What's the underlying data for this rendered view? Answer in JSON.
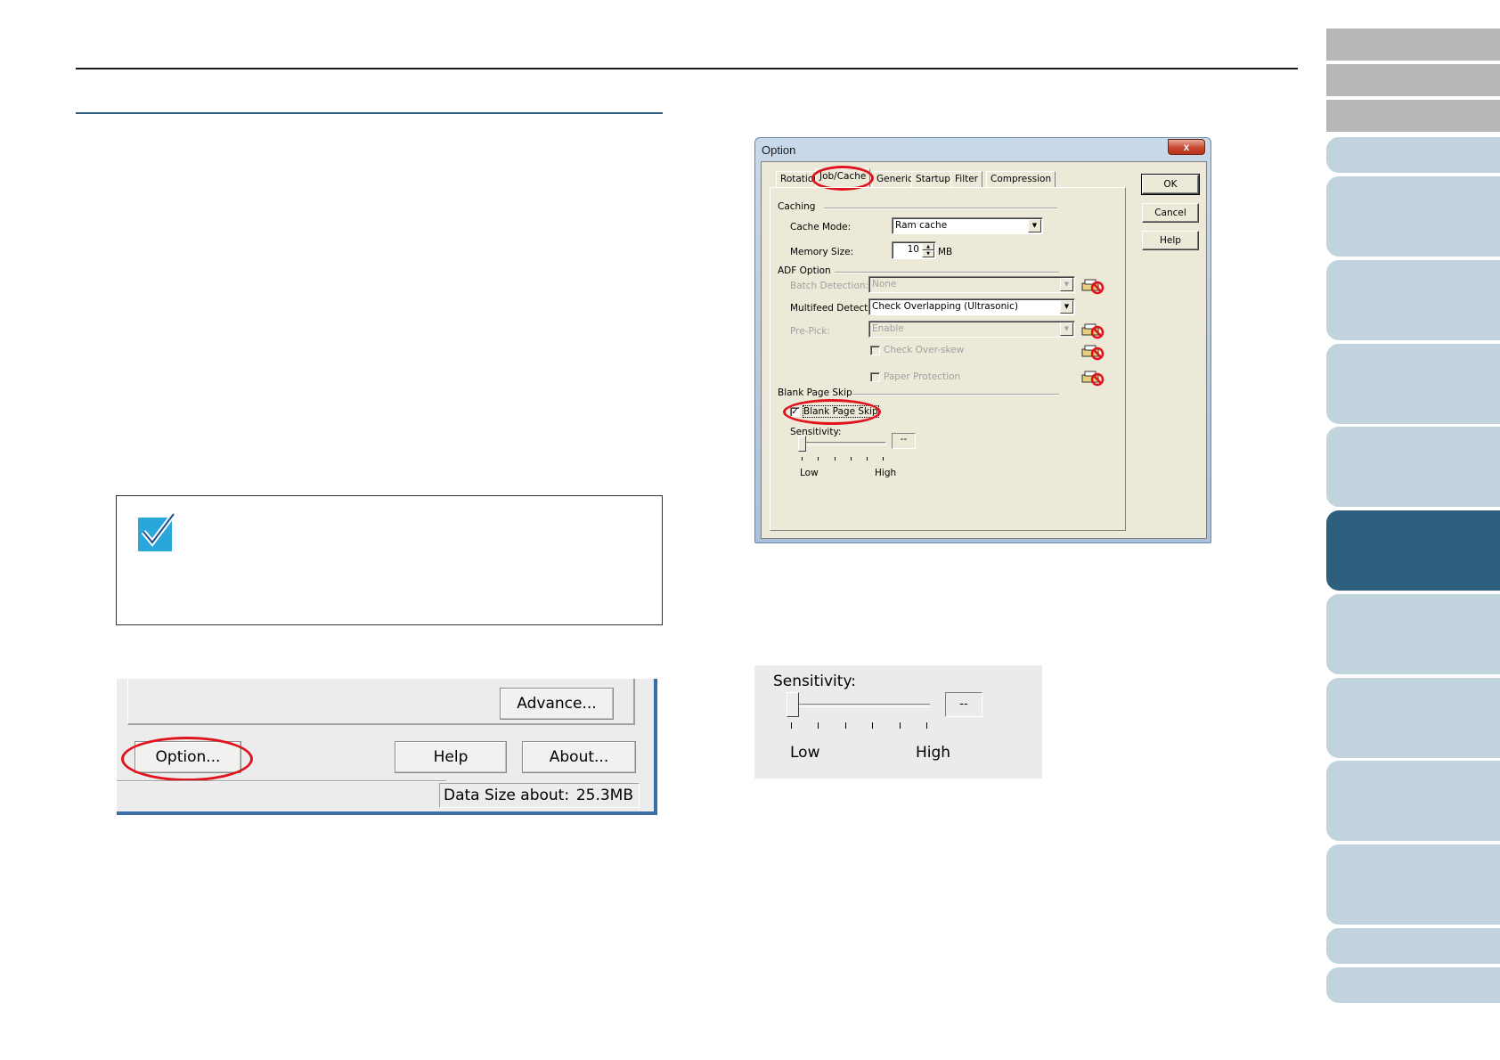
{
  "option_dialog": {
    "title": "Option",
    "close_glyph": "x",
    "tabs": [
      "Rotation",
      "Job/Cache",
      "Generic",
      "Startup",
      "Filter",
      "Compression"
    ],
    "active_tab": "Job/Cache",
    "buttons": {
      "ok": "OK",
      "cancel": "Cancel",
      "help": "Help"
    },
    "caching": {
      "group": "Caching",
      "cache_mode_label": "Cache Mode:",
      "cache_mode_value": "Ram cache",
      "memory_size_label": "Memory Size:",
      "memory_size_value": "10",
      "memory_unit": "MB"
    },
    "adf": {
      "group": "ADF Option",
      "batch_detection_label": "Batch Detection:",
      "batch_detection_value": "None",
      "multifeed_label": "Multifeed Detection:",
      "multifeed_value": "Check Overlapping (Ultrasonic)",
      "prepick_label": "Pre-Pick:",
      "prepick_value": "Enable",
      "check_overskew_label": "Check Over-skew",
      "paper_protection_label": "Paper Protection"
    },
    "blank_page": {
      "group": "Blank Page Skip",
      "checkbox_label": "Blank Page Skip",
      "checked": true,
      "sensitivity_label": "Sensitivity:",
      "sensitivity_value": "--",
      "low": "Low",
      "high": "High"
    }
  },
  "sensitivity_zoom": {
    "label": "Sensitivity:",
    "value": "--",
    "low": "Low",
    "high": "High"
  },
  "bottom_buttons_zoom": {
    "advance": "Advance...",
    "option": "Option...",
    "help": "Help",
    "about": "About...",
    "data_size_label": "Data Size about:",
    "data_size_value": "25.3MB"
  },
  "colors": {
    "highlight_oval": "#e0141c",
    "active_side_tab": "#2e5f7e",
    "side_tab": "#c1d3dd",
    "hint_check": "#29a7dd"
  }
}
